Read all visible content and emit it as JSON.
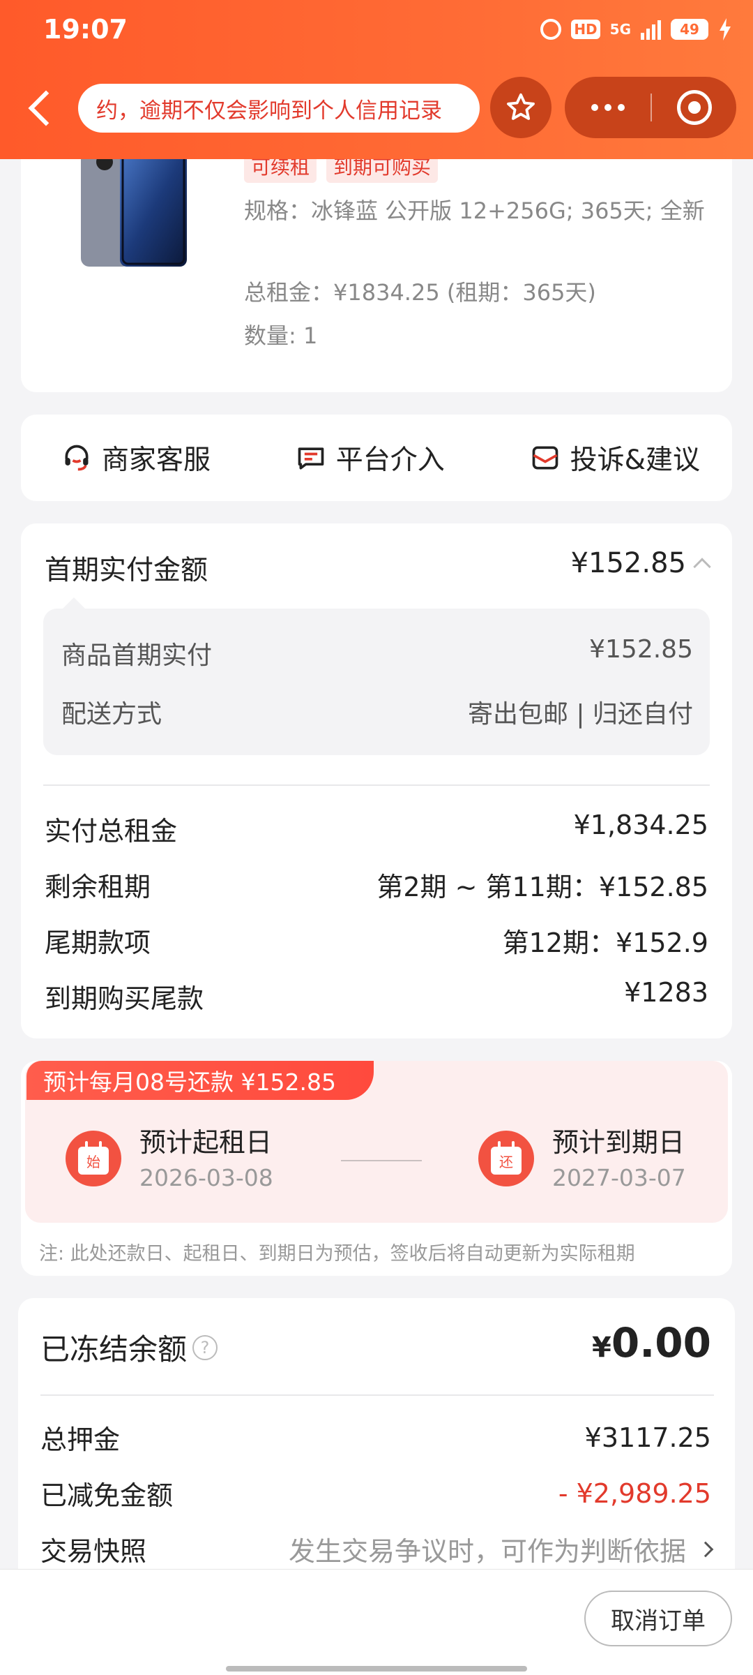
{
  "status_bar": {
    "time": "19:07",
    "hd": "HD",
    "network": "5G",
    "battery": "49"
  },
  "nav": {
    "marquee_text": "约，逾期不仅会影响到个人信用记录",
    "icons": [
      "back-arrow-icon",
      "star-icon",
      "more-icon",
      "close-circle-icon"
    ]
  },
  "product": {
    "tags": [
      "可续租",
      "到期可购买"
    ],
    "spec": "规格：冰锋蓝 公开版 12+256G; 365天; 全新",
    "rent_total": "总租金：¥1834.25 (租期：365天)",
    "quantity": "数量: 1"
  },
  "services": {
    "merchant": "商家客服",
    "platform": "平台介入",
    "complaint": "投诉&建议"
  },
  "payment": {
    "first_label": "首期实付金额",
    "first_value": "¥152.85",
    "detail": {
      "goods_label": "商品首期实付",
      "goods_value": "¥152.85",
      "shipping_label": "配送方式",
      "shipping_value": "寄出包邮 | 归还自付"
    },
    "total_label": "实付总租金",
    "total_value": "¥1,834.25",
    "remaining_label": "剩余租期",
    "remaining_value": "第2期 ~ 第11期：¥152.85",
    "final_label": "尾期款项",
    "final_value": "第12期：¥152.9",
    "buyout_label": "到期购买尾款",
    "buyout_value": "¥1283"
  },
  "schedule": {
    "banner": "预计每月08号还款 ¥152.85",
    "start_icon_text": "始",
    "start_label": "预计起租日",
    "start_date": "2026-03-08",
    "end_icon_text": "还",
    "end_label": "预计到期日",
    "end_date": "2027-03-07",
    "note": "注: 此处还款日、起租日、到期日为预估，签收后将自动更新为实际租期"
  },
  "balance": {
    "title": "已冻结余额",
    "help": "?",
    "currency": "¥",
    "amount": "0.00",
    "deposit_label": "总押金",
    "deposit_value": "¥3117.25",
    "waived_label": "已减免金额",
    "waived_value": "- ¥2,989.25",
    "snapshot_label": "交易快照",
    "snapshot_value": "发生交易争议时，可作为判断依据"
  },
  "actions": {
    "cancel_order": "取消订单"
  },
  "colors": {
    "header": "#ff6b35",
    "accent_red": "#e23a2c",
    "page_bg": "#f4f4f6"
  }
}
